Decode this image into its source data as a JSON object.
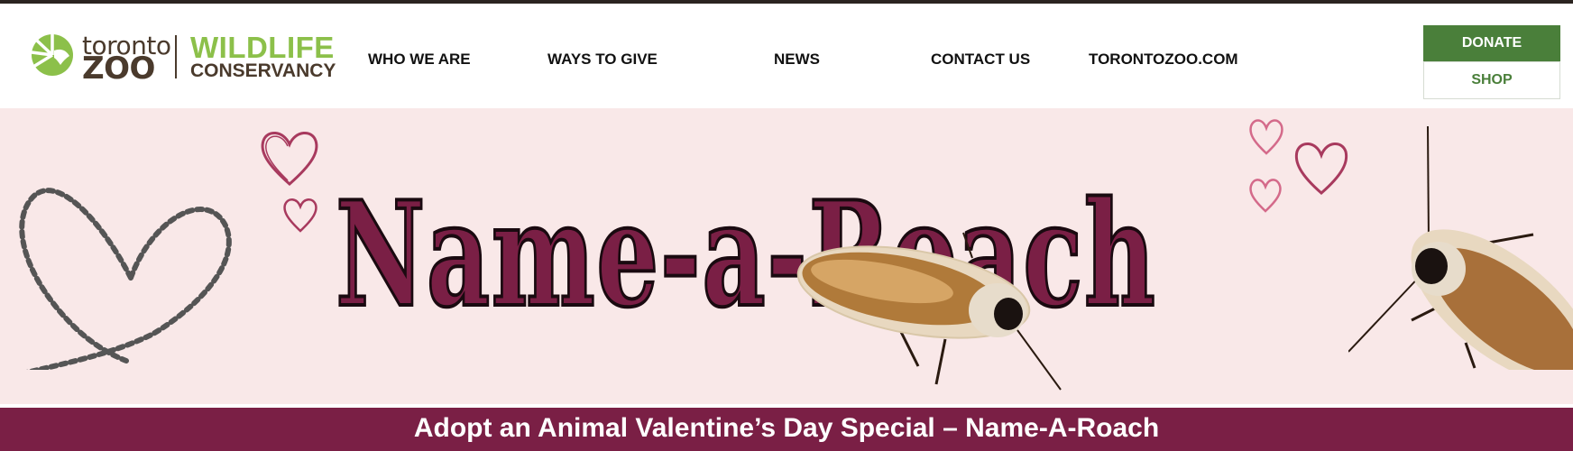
{
  "header": {
    "logo": {
      "toronto": "toronto",
      "zoo": "ZOO",
      "wildlife": "WILDLIFE",
      "conservancy": "CONSERVANCY"
    },
    "nav": [
      {
        "label": "WHO WE ARE"
      },
      {
        "label": "WAYS TO GIVE"
      },
      {
        "label": "NEWS"
      },
      {
        "label": "CONTACT US"
      },
      {
        "label": "TORONTOZOO.COM"
      }
    ],
    "donate_label": "DONATE",
    "shop_label": "SHOP"
  },
  "banner": {
    "title": "Name-a-Roach",
    "images": [
      "ant-trail-heart",
      "doodle-hearts",
      "cockroach"
    ]
  },
  "strip": {
    "text": "Adopt an Animal Valentine’s Day Special – Name-A-Roach"
  },
  "colors": {
    "brand_green": "#4a7f3a",
    "logo_green": "#8cc04a",
    "logo_brown": "#4a3a2c",
    "maroon": "#7a1f45",
    "banner_pink": "#f9e8e8"
  }
}
